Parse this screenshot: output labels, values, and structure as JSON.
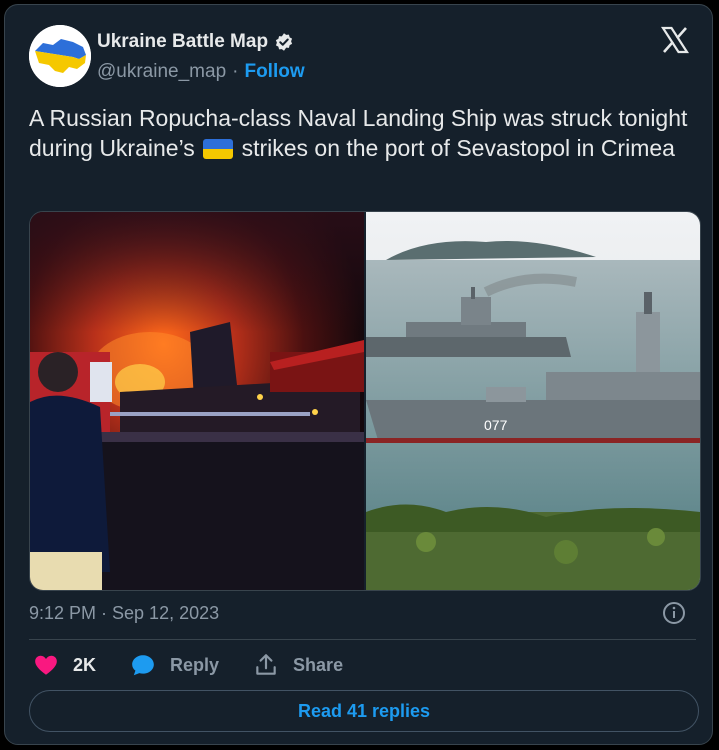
{
  "author": {
    "name": "Ukraine Battle Map",
    "handle": "@ukraine_map",
    "separator": "·",
    "follow_label": "Follow"
  },
  "tweet": {
    "text_part1": "A Russian Ropucha-class Naval Landing Ship was struck tonight during Ukraine’s",
    "text_part2": "strikes on the port of Sevastopol in Crimea",
    "timestamp": "9:12 PM · Sep 12, 2023"
  },
  "media": {
    "ship_hull_number": "077"
  },
  "actions": {
    "like_count": "2K",
    "reply_label": "Reply",
    "share_label": "Share"
  },
  "read_replies_label": "Read 41 replies",
  "colors": {
    "background": "#15202b",
    "accent": "#1d9bf0",
    "heart": "#f91880",
    "text": "#e7e9ea",
    "muted": "#8b98a5"
  },
  "icons": [
    "verified-badge-icon",
    "x-logo-icon",
    "info-icon",
    "heart-icon",
    "reply-bubble-icon",
    "share-icon"
  ]
}
